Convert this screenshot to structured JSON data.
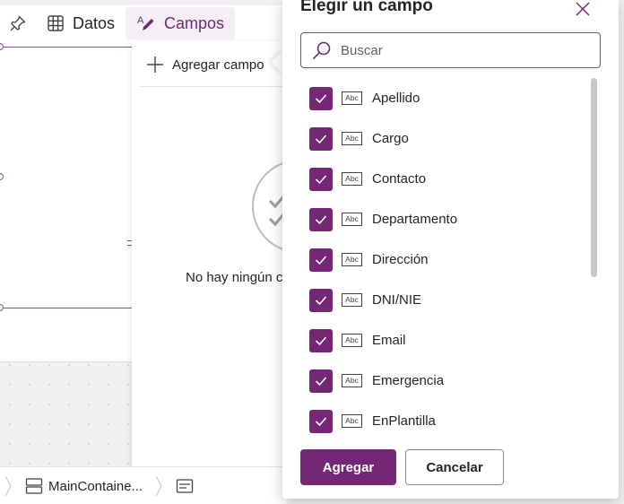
{
  "toolbar": {
    "pin_icon": "pin-icon",
    "data_label": "Datos",
    "data_icon": "table-icon",
    "fields_label": "Campos",
    "fields_icon": "pen-field-icon"
  },
  "fields_pane": {
    "add_field_label": "Agregar campo",
    "empty_text": "No hay ningún c"
  },
  "breadcrumb": {
    "main_container_label": "MainContaine..."
  },
  "dialog": {
    "title": "Elegir un campo",
    "search_placeholder": "Buscar",
    "fields": [
      {
        "name": "Apellido",
        "checked": true,
        "type": "Abc"
      },
      {
        "name": "Cargo",
        "checked": true,
        "type": "Abc"
      },
      {
        "name": "Contacto",
        "checked": true,
        "type": "Abc"
      },
      {
        "name": "Departamento",
        "checked": true,
        "type": "Abc"
      },
      {
        "name": "Dirección",
        "checked": true,
        "type": "Abc"
      },
      {
        "name": "DNI/NIE",
        "checked": true,
        "type": "Abc"
      },
      {
        "name": "Email",
        "checked": true,
        "type": "Abc"
      },
      {
        "name": "Emergencia",
        "checked": true,
        "type": "Abc"
      },
      {
        "name": "EnPlantilla",
        "checked": true,
        "type": "Abc"
      }
    ],
    "add_button": "Agregar",
    "cancel_button": "Cancelar"
  },
  "colors": {
    "accent": "#742774",
    "accent_light": "#f5eef7",
    "text": "#242424"
  }
}
